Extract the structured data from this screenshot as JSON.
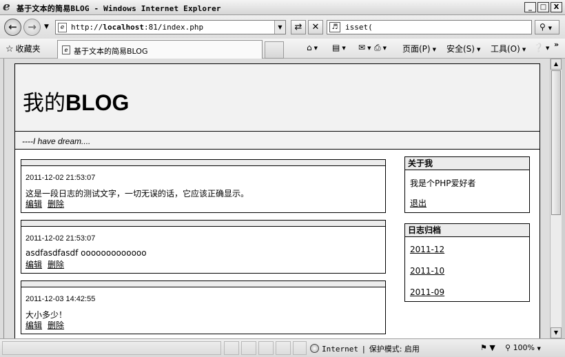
{
  "window": {
    "title": "基于文本的简易BLOG - Windows Internet Explorer",
    "minimize": "_",
    "maximize": "□",
    "close": "X"
  },
  "address": {
    "url_prefix": "http://",
    "url_host": "localhost",
    "url_rest": ":81/index.php",
    "search_value": "isset("
  },
  "favorites": {
    "label": "收藏夹",
    "tab_title": "基于文本的简易BLOG"
  },
  "commandbar": {
    "page": "页面(P)",
    "safety": "安全(S)",
    "tools": "工具(O)"
  },
  "blog": {
    "title_prefix": "我的",
    "title_main": "BLOG",
    "slogan": "----I have dream....",
    "posts": [
      {
        "date": "2011-12-02 21:53:07",
        "text": "这是一段日志的测试文字，一切无误的话，它应该正确显示。",
        "edit": "编辑",
        "delete": "删除"
      },
      {
        "date": "2011-12-02 21:53:07",
        "text": "asdfasdfasdf ooooooooooooo",
        "edit": "编辑",
        "delete": "删除"
      },
      {
        "date": "2011-12-03 14:42:55",
        "text": "大小多少！",
        "edit": "编辑",
        "delete": "删除"
      }
    ],
    "about": {
      "heading": "关于我",
      "intro": "我是个PHP爱好者",
      "logout": "退出"
    },
    "archive": {
      "heading": "日志归档",
      "items": [
        "2011-12",
        "2011-10",
        "2011-09"
      ]
    }
  },
  "status": {
    "zone": "Internet",
    "protected_mode": "保护模式: 启用",
    "zoom": "100%"
  },
  "colors": {
    "header_bg": "#f2f2f2",
    "chrome_bg": "#dedede"
  }
}
